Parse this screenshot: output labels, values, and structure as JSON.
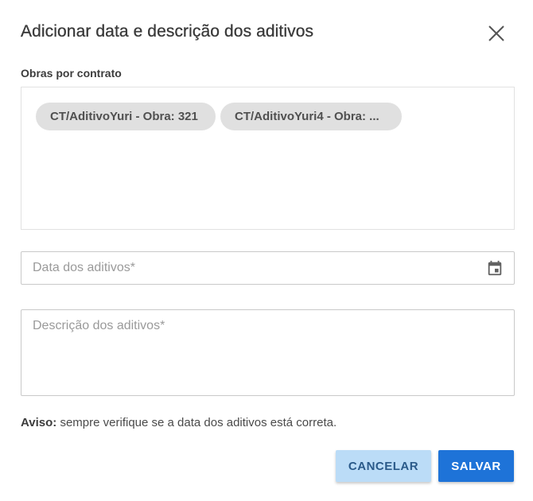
{
  "dialog": {
    "title": "Adicionar data e descrição dos aditivos",
    "close_icon": "close-icon"
  },
  "contracts": {
    "label": "Obras por contrato",
    "chips": [
      {
        "label": "CT/AditivoYuri - Obra: 321"
      },
      {
        "label": "CT/AditivoYuri4 - Obra: ..."
      }
    ]
  },
  "date_field": {
    "placeholder": "Data dos aditivos*",
    "value": "",
    "icon": "calendar-icon"
  },
  "description_field": {
    "placeholder": "Descrição dos aditivos*",
    "value": ""
  },
  "notice": {
    "label": "Aviso:",
    "text": " sempre verifique se a data dos aditivos está correta."
  },
  "actions": {
    "cancel_label": "CANCELAR",
    "save_label": "SALVAR"
  },
  "colors": {
    "chip_bg": "#e0e0e0",
    "cancel_bg": "#bbdcf7",
    "save_bg": "#1e73d8"
  }
}
